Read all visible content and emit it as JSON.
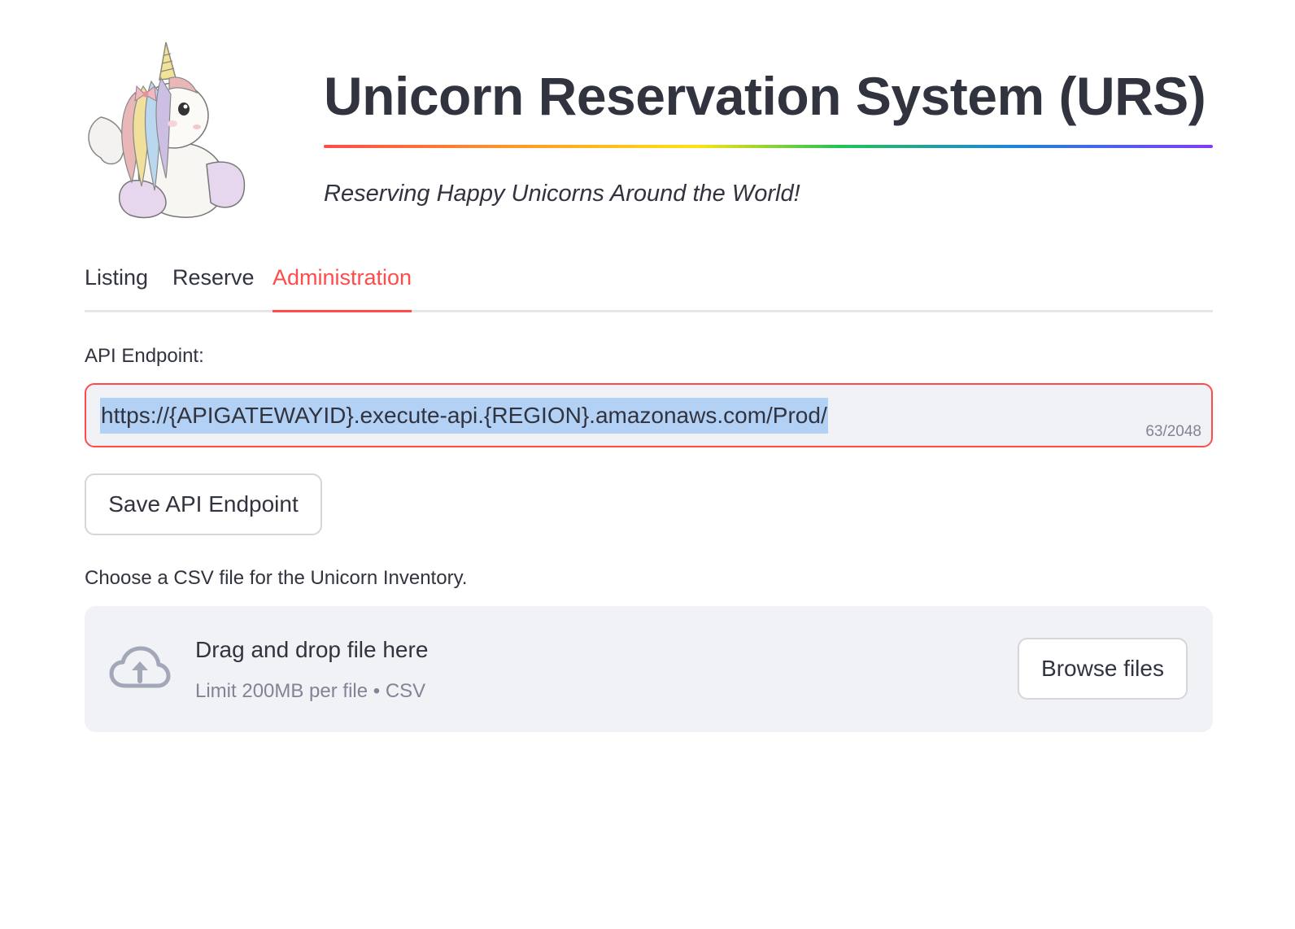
{
  "header": {
    "title": "Unicorn Reservation System (URS)",
    "subtitle": "Reserving Happy Unicorns Around the World!",
    "logo_icon": "unicorn-logo"
  },
  "tabs": [
    {
      "label": "Listing",
      "active": false
    },
    {
      "label": "Reserve",
      "active": false
    },
    {
      "label": "Administration",
      "active": true
    }
  ],
  "api": {
    "label": "API Endpoint:",
    "value": "https://{APIGATEWAYID}.execute-api.{REGION}.amazonaws.com/Prod/",
    "char_count": "63/2048",
    "save_label": "Save API Endpoint"
  },
  "upload": {
    "label": "Choose a CSV file for the Unicorn Inventory.",
    "drop_text": "Drag and drop file here",
    "limit_text": "Limit 200MB per file • CSV",
    "browse_label": "Browse files",
    "icon": "cloud-upload-icon"
  },
  "colors": {
    "accent": "#ff4b4b",
    "text": "#31333f",
    "muted": "#808495",
    "input_bg": "#f0f2f6",
    "selection": "#b3d1f5"
  }
}
